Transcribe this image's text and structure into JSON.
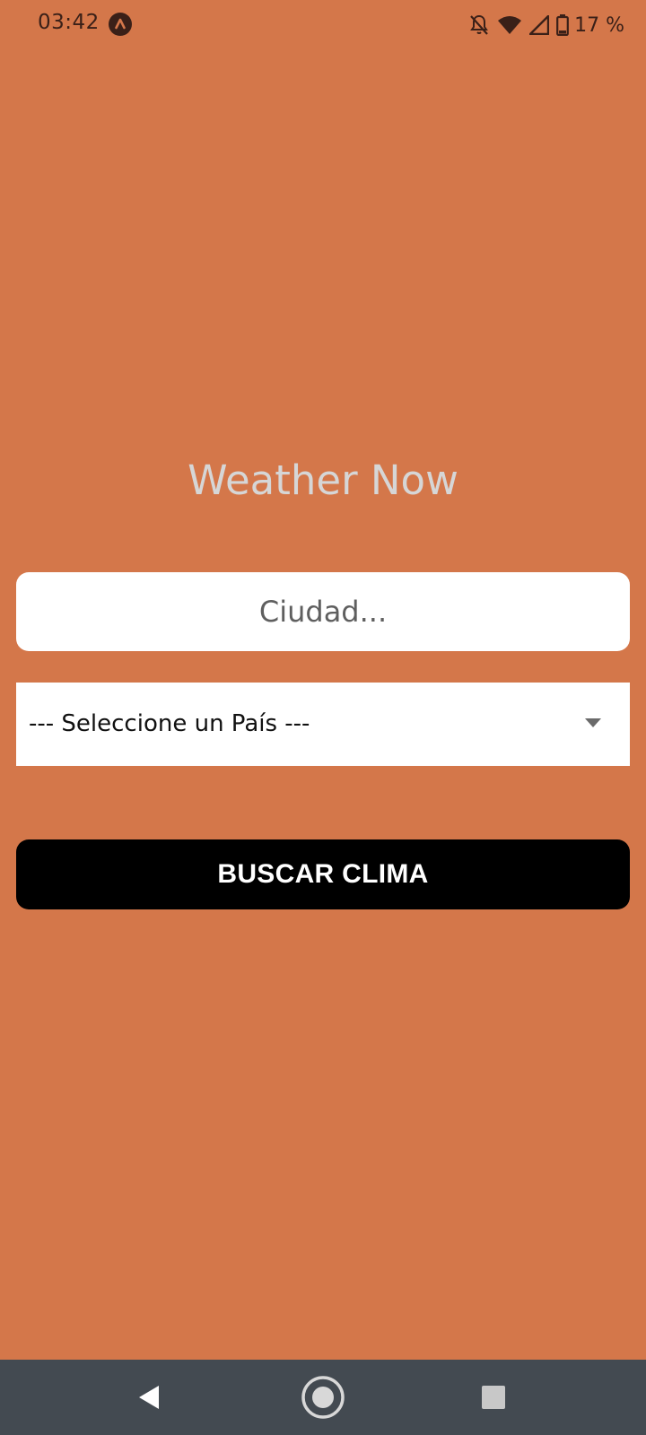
{
  "status_bar": {
    "time": "03:42",
    "app_badge_icon": "app-notification-icon",
    "icons": [
      "alarm-off-icon",
      "wifi-icon",
      "cell-signal-icon",
      "battery-icon"
    ],
    "battery_percent": "17 %"
  },
  "app": {
    "title": "Weather Now",
    "background_color": "#D4774A"
  },
  "form": {
    "city_input": {
      "placeholder": "Ciudad...",
      "value": ""
    },
    "country_select": {
      "selected": "--- Seleccione un País ---"
    },
    "search_button_label": "BUSCAR CLIMA"
  },
  "nav_bar": {
    "buttons": [
      "back-icon",
      "home-icon",
      "recents-icon"
    ]
  }
}
